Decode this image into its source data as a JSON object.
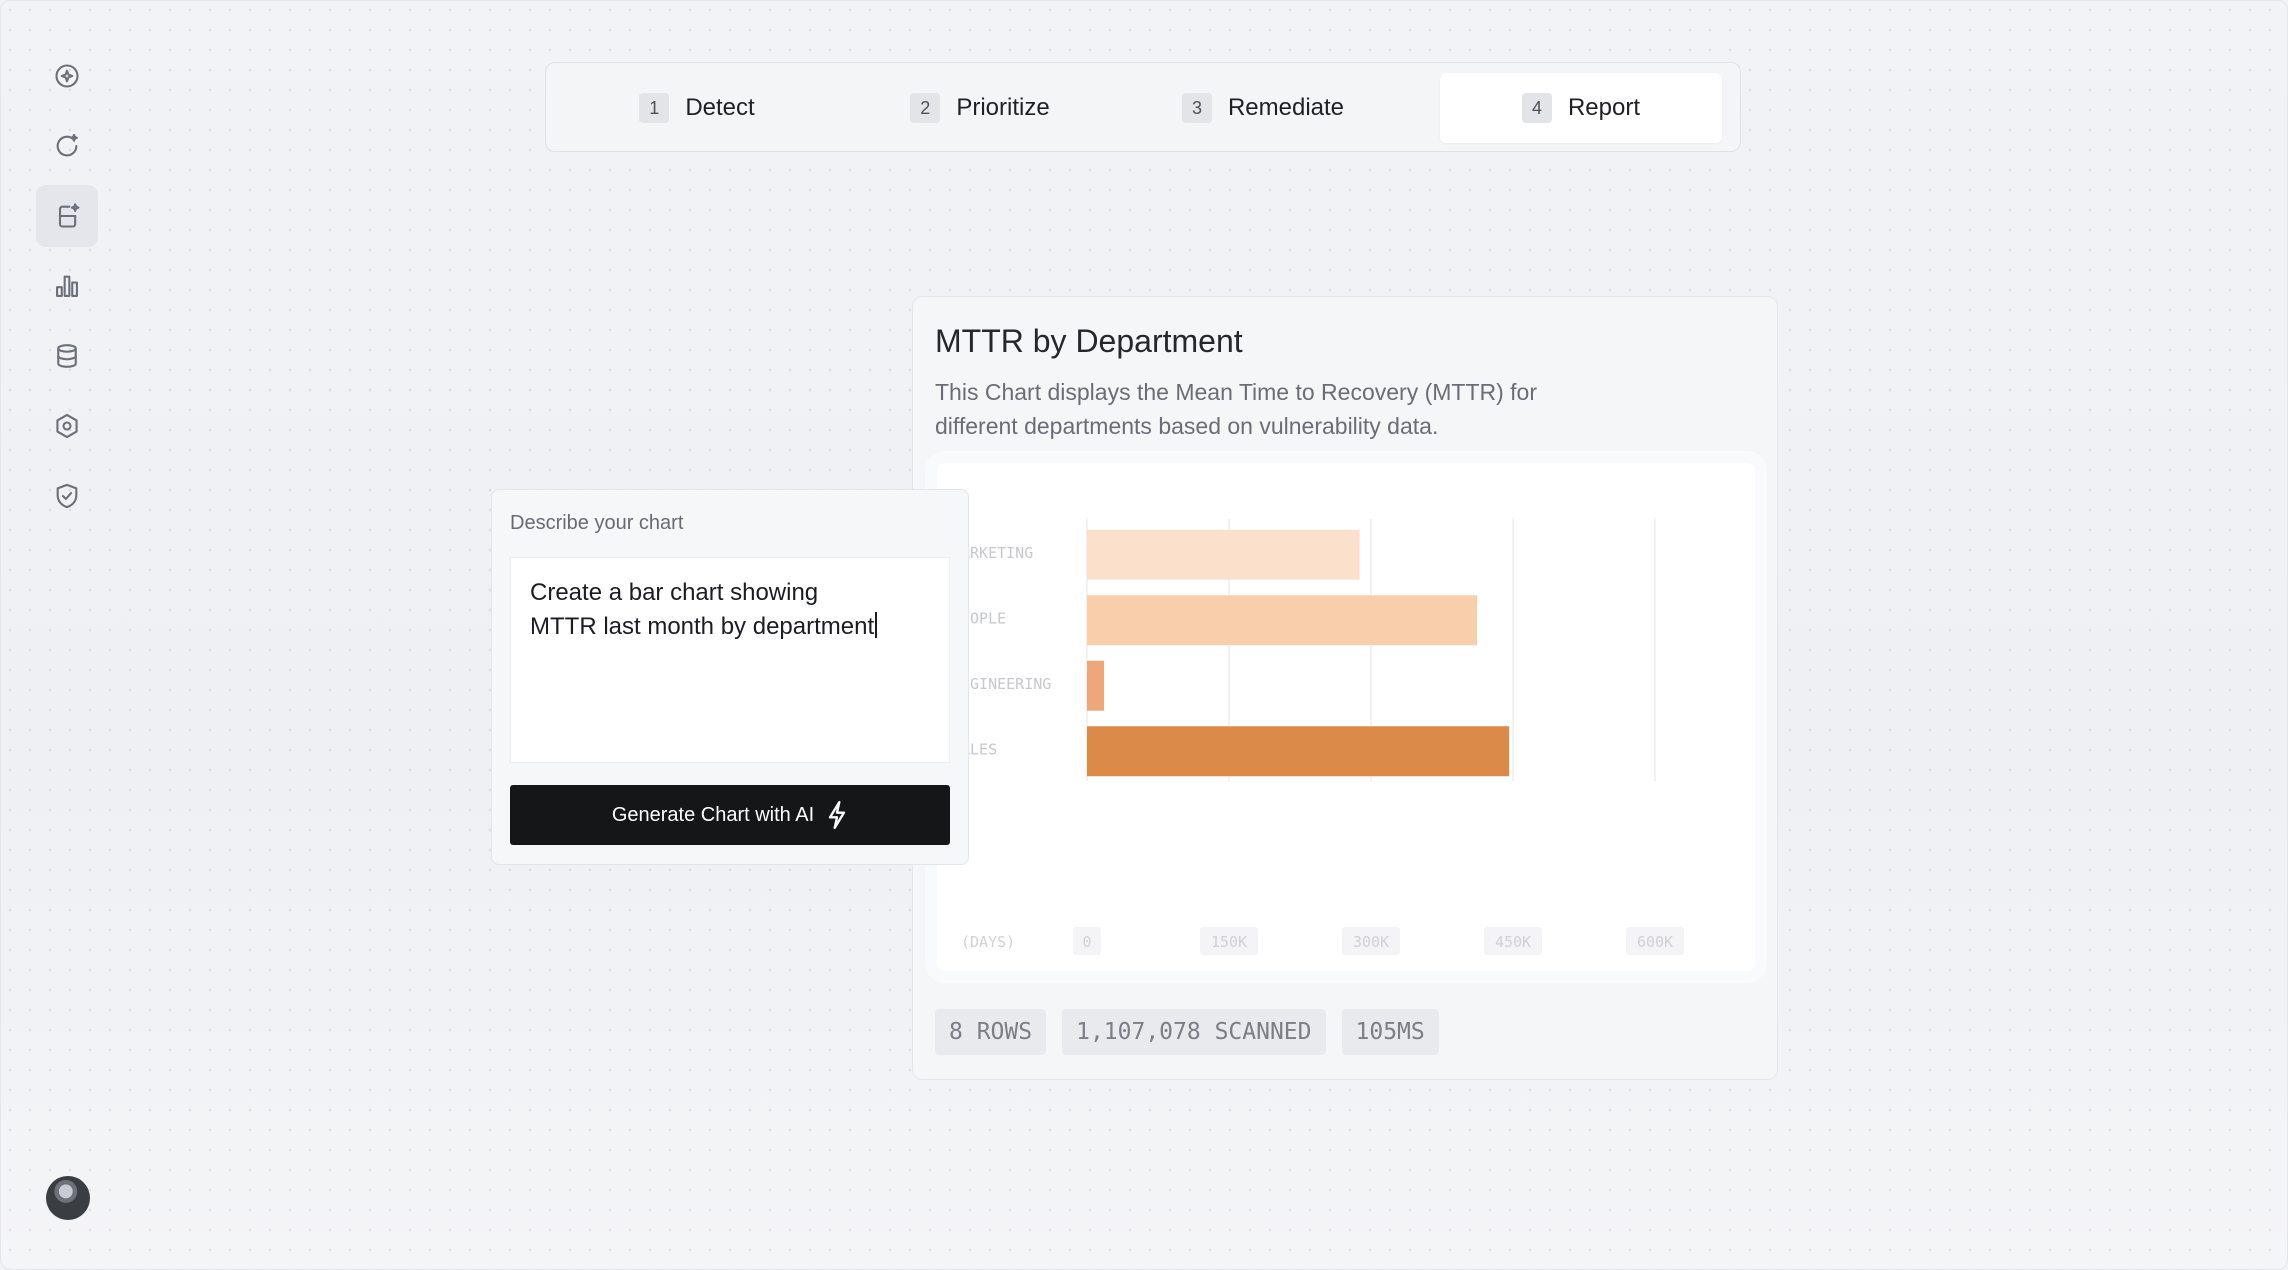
{
  "sidebar": {
    "items": [
      {
        "icon": "sparkle-ball-icon",
        "active": false
      },
      {
        "icon": "refresh-sparkle-icon",
        "active": false
      },
      {
        "icon": "document-sparkle-icon",
        "active": true
      },
      {
        "icon": "bar-chart-icon",
        "active": false
      },
      {
        "icon": "database-icon",
        "active": false
      },
      {
        "icon": "hexagon-settings-icon",
        "active": false
      },
      {
        "icon": "shield-check-icon",
        "active": false
      }
    ],
    "avatar": "user-avatar"
  },
  "steps": [
    {
      "num": "1",
      "label": "Detect",
      "active": false
    },
    {
      "num": "2",
      "label": "Prioritize",
      "active": false
    },
    {
      "num": "3",
      "label": "Remediate",
      "active": false
    },
    {
      "num": "4",
      "label": "Report",
      "active": true
    }
  ],
  "chart_card": {
    "title": "MTTR by Department",
    "description": "This Chart displays the Mean Time to Recovery (MTTR) for different departments based on vulnerability data.",
    "stats": [
      "8 ROWS",
      "1,107,078 SCANNED",
      "105MS"
    ]
  },
  "prompt": {
    "label": "Describe your chart",
    "value": "Create a bar chart showing\nMTTR last month by department",
    "button_label": "Generate Chart with AI"
  },
  "chart_data": {
    "type": "bar",
    "orientation": "horizontal",
    "categories": [
      "ARKETING",
      "EOPLE",
      "NGINEERING",
      "ALES"
    ],
    "values": [
      288000,
      412000,
      18000,
      446000
    ],
    "bar_colors": [
      "#fbe0cb",
      "#f9ceab",
      "#eea778",
      "#dc8a4a"
    ],
    "xlabel": "(DAYS)",
    "xticks": [
      "0",
      "150K",
      "300K",
      "450K",
      "600K"
    ],
    "xtick_values": [
      0,
      150000,
      300000,
      450000,
      600000
    ],
    "xlim": [
      0,
      600000
    ],
    "grid": true
  }
}
